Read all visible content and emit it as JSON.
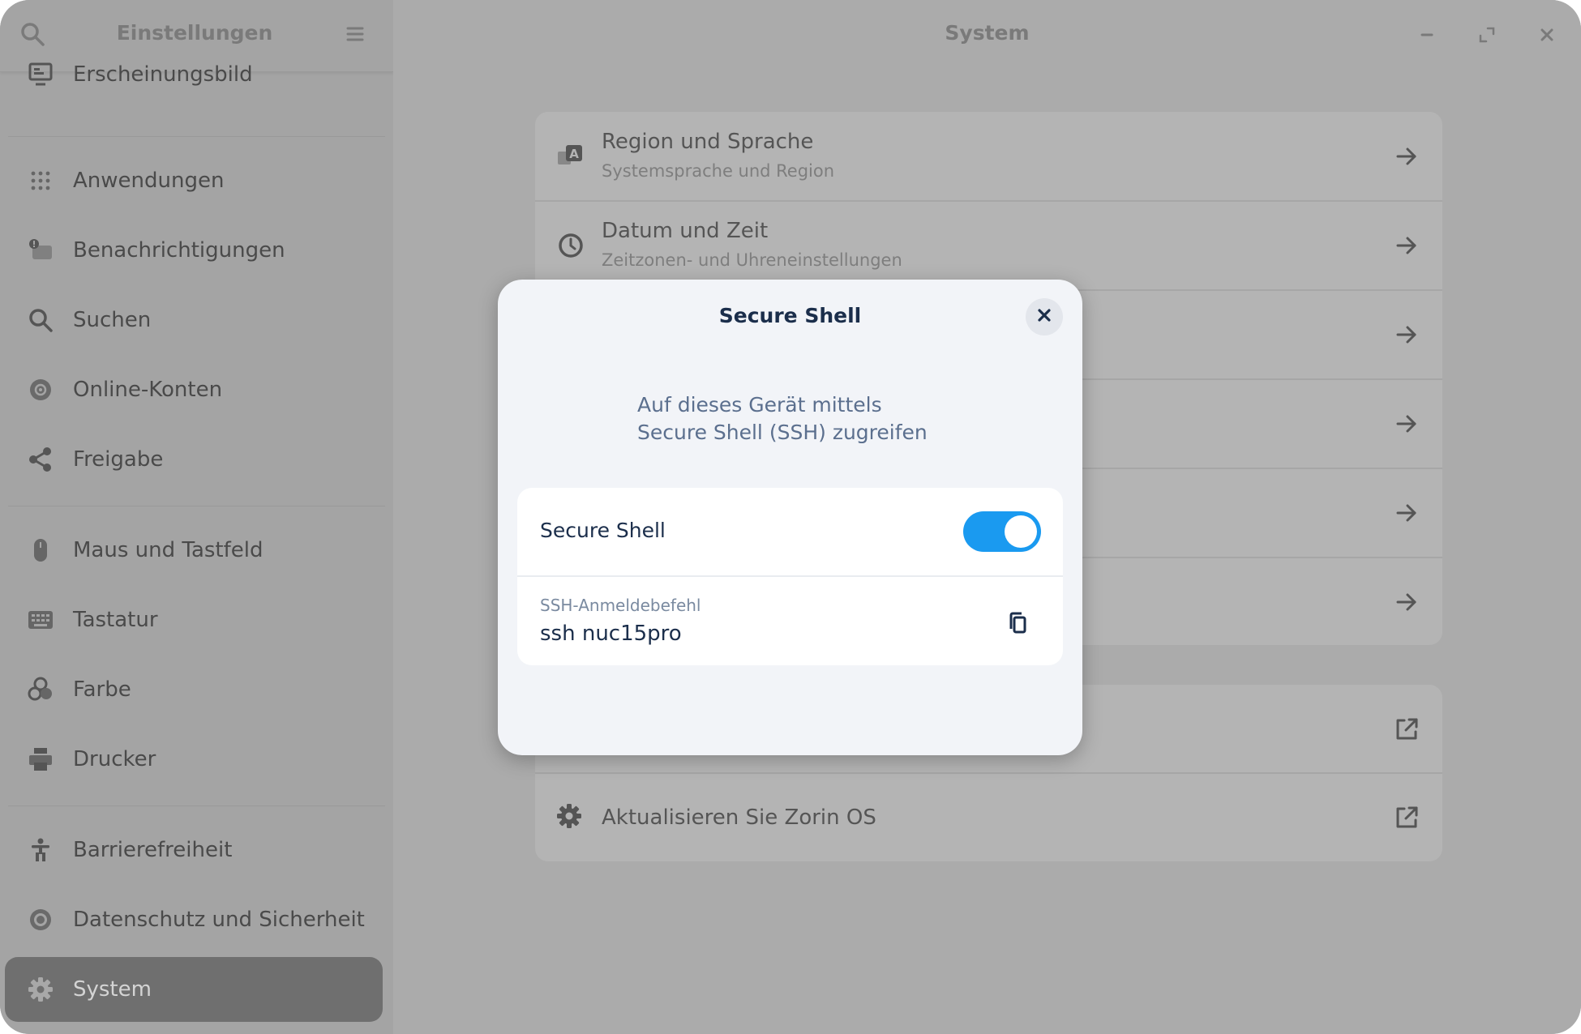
{
  "sidebar": {
    "title": "Einstellungen",
    "items": [
      {
        "label": "Erscheinungsbild",
        "icon": "monitor-icon"
      },
      {
        "label": "Anwendungen",
        "icon": "apps-grid-icon"
      },
      {
        "label": "Benachrichtigungen",
        "icon": "notification-icon"
      },
      {
        "label": "Suchen",
        "icon": "search-icon"
      },
      {
        "label": "Online-Konten",
        "icon": "online-accounts-icon"
      },
      {
        "label": "Freigabe",
        "icon": "share-icon"
      },
      {
        "label": "Maus und Tastfeld",
        "icon": "mouse-icon"
      },
      {
        "label": "Tastatur",
        "icon": "keyboard-icon"
      },
      {
        "label": "Farbe",
        "icon": "color-icon"
      },
      {
        "label": "Drucker",
        "icon": "printer-icon"
      },
      {
        "label": "Barrierefreiheit",
        "icon": "accessibility-icon"
      },
      {
        "label": "Datenschutz und Sicherheit",
        "icon": "privacy-icon"
      },
      {
        "label": "System",
        "icon": "gear-icon",
        "active": true
      }
    ]
  },
  "header": {
    "title": "System"
  },
  "system_rows": [
    {
      "title": "Region und Sprache",
      "subtitle": "Systemsprache und Region",
      "icon": "region-language-icon"
    },
    {
      "title": "Datum und Zeit",
      "subtitle": "Zeitzonen- und Uhreneinstellungen",
      "icon": "clock-icon"
    }
  ],
  "system_rows_extra": [
    {
      "title": "Aktualisieren Sie Zorin OS",
      "icon": "update-gear-icon"
    }
  ],
  "dialog": {
    "title": "Secure Shell",
    "description_line1": "Auf dieses Gerät mittels",
    "description_line2": "Secure Shell (SSH) zugreifen",
    "toggle_label": "Secure Shell",
    "toggle_on": true,
    "command_label": "SSH-Anmeldebefehl",
    "command_value": "ssh nuc15pro"
  },
  "colors": {
    "accent": "#1a9af0",
    "dialog_text": "#1b2e4b",
    "dim_overlay": "#ababab"
  }
}
